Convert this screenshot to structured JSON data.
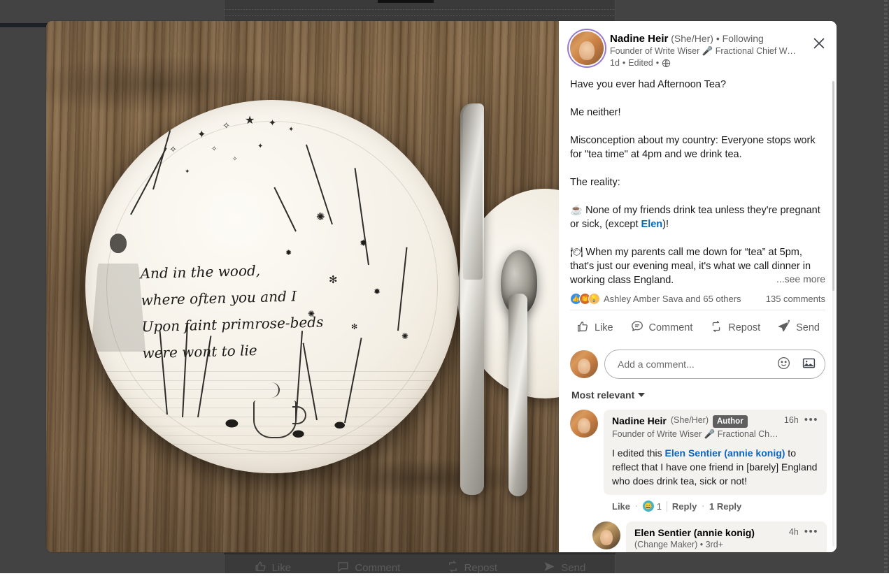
{
  "background": {
    "actions": [
      {
        "label": "Like",
        "icon": "thumbs-up-icon"
      },
      {
        "label": "Comment",
        "icon": "comment-bubble-icon"
      },
      {
        "label": "Repost",
        "icon": "repost-icon"
      },
      {
        "label": "Send",
        "icon": "send-icon"
      }
    ]
  },
  "modal": {
    "close_label": "Dismiss",
    "media": {
      "alt": "Hand-illustrated ceramic plate with knife and spoon on a wooden table",
      "plate_quote": "And in the wood,\nwhere often you and I\nUpon faint primrose-beds\nwere wont to lie"
    },
    "post": {
      "author": {
        "name": "Nadine Heir",
        "pronouns": "(She/Her)",
        "separator": "•",
        "follow_status": "Following",
        "headline": "Founder of Write Wiser 🎤 Fractional Chief Writin...",
        "time": "1d",
        "edited": "Edited",
        "visibility_icon": "globe-icon"
      },
      "paragraphs": [
        {
          "text": "Have you ever had Afternoon Tea?"
        },
        {
          "text": "Me neither!"
        },
        {
          "text": "Misconception about my country: Everyone stops work for \"tea time\" at 4pm and we drink tea."
        },
        {
          "text": "The reality:"
        },
        {
          "text": "☕ None of my friends drink tea unless they're pregnant or sick, (except ",
          "link": "Elen",
          "text_after": ")!"
        },
        {
          "text": "🍽 When my parents call me down for “tea” at 5pm, that's just our evening meal, it's what we call dinner in working class England."
        }
      ],
      "see_more": "...see more",
      "reactions": {
        "icons": [
          "like-reaction-icon",
          "celebrate-reaction-icon",
          "insightful-reaction-icon"
        ],
        "summary": "Ashley Amber Sava and 65 others"
      },
      "comments_count": "135 comments",
      "actions": [
        {
          "label": "Like",
          "icon": "thumbs-up-icon"
        },
        {
          "label": "Comment",
          "icon": "comment-bubble-icon"
        },
        {
          "label": "Repost",
          "icon": "repost-icon"
        },
        {
          "label": "Send",
          "icon": "send-icon"
        }
      ]
    },
    "composer": {
      "placeholder": "Add a comment...",
      "emoji_icon": "emoji-icon",
      "image_icon": "image-icon"
    },
    "sort": {
      "label": "Most relevant",
      "caret_icon": "chevron-down-icon"
    },
    "comments": [
      {
        "name": "Nadine Heir",
        "pronouns": "(She/Her)",
        "badge": "Author",
        "time": "16h",
        "menu_icon": "overflow-menu-icon",
        "headline": "Founder of Write Wiser 🎤 Fractional Chief ...",
        "text_before": "I edited this ",
        "link": "Elen Sentier (annie konig)",
        "text_after": " to reflect that I have one friend in [barely] England who does drink tea, sick or not!",
        "actions": {
          "like": "Like",
          "reaction_icon": "funny-reaction-icon",
          "reaction_count": "1",
          "reply": "Reply",
          "reply_count": "1 Reply"
        }
      },
      {
        "name": "Elen Sentier (annie konig)",
        "pronouns": "",
        "badge": "",
        "time": "4h",
        "menu_icon": "overflow-menu-icon",
        "headline": "(Change Maker) • 3rd+",
        "text_before": "",
        "link": "",
        "text_after": ""
      }
    ]
  }
}
